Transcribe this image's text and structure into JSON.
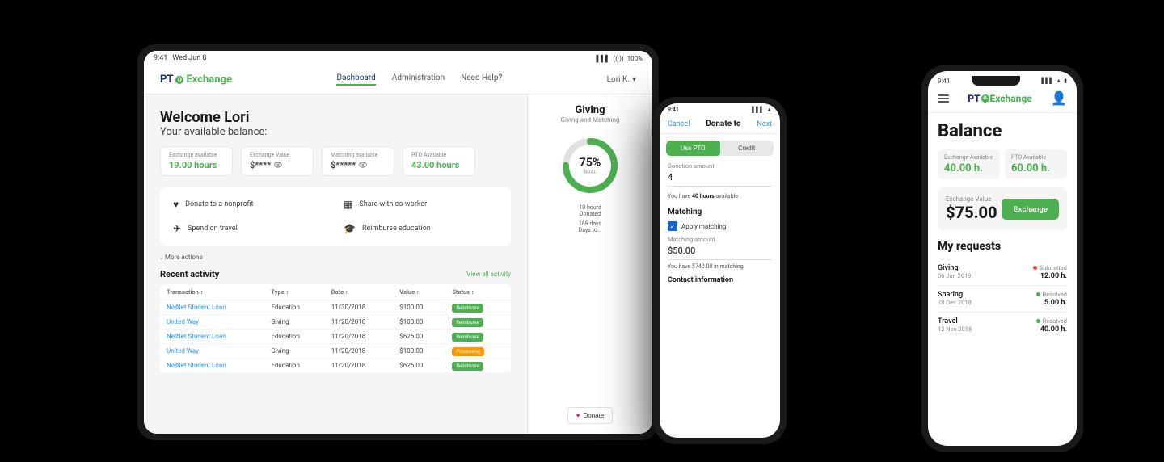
{
  "app": {
    "name": "PTO Exchange",
    "logo_pto": "PT",
    "logo_o": "O",
    "logo_exchange": "Exchange"
  },
  "tablet": {
    "status": {
      "time": "9:41",
      "date": "Wed Jun 8",
      "battery": "100%"
    },
    "nav": {
      "links": [
        "Dashboard",
        "Administration",
        "Need Help?"
      ],
      "active": "Dashboard",
      "user": "Lori K."
    },
    "welcome": {
      "greeting": "Welcome Lori",
      "balance_label": "Your available balance:"
    },
    "balance_cards": [
      {
        "label": "Exchange available",
        "value": "19.00 hours",
        "type": "text"
      },
      {
        "label": "Exchange Value",
        "value": "$****",
        "type": "masked"
      },
      {
        "label": "Matching available",
        "value": "$*****",
        "type": "masked"
      },
      {
        "label": "PTO Available",
        "value": "43.00 hours",
        "type": "text"
      }
    ],
    "actions": [
      {
        "icon": "♥",
        "label": "Donate to a nonprofit"
      },
      {
        "icon": "▦",
        "label": "Share with co-worker"
      },
      {
        "icon": "✈",
        "label": "Spend on travel"
      },
      {
        "icon": "🎓",
        "label": "Reimburse education"
      }
    ],
    "more_actions": "↓ More actions",
    "recent": {
      "title": "Recent activity",
      "view_all": "View all activity",
      "headers": [
        "Transaction ↕",
        "Type ↕",
        "Date ↕",
        "Value ↕",
        "Status ↕"
      ],
      "rows": [
        {
          "name": "NelNet Student Loan",
          "type": "Education",
          "date": "11/30/2018",
          "value": "$100.00",
          "status": "Reimburse"
        },
        {
          "name": "United Way",
          "type": "Giving",
          "date": "11/20/2018",
          "value": "$100.00",
          "status": "Reimburse"
        },
        {
          "name": "NelNet Student Loan",
          "type": "Education",
          "date": "11/20/2018",
          "value": "$625.00",
          "status": "Reimburse"
        },
        {
          "name": "United Way",
          "type": "Giving",
          "date": "11/20/2018",
          "value": "$100.00",
          "status": "Processing"
        },
        {
          "name": "NelNet Student Loan",
          "type": "Education",
          "date": "11/20/2018",
          "value": "$625.00",
          "status": "Reimburse"
        }
      ]
    },
    "giving": {
      "title": "Giving",
      "subtitle": "Giving and Matching",
      "percent": "75%",
      "goal_label": "GOAL",
      "donated": "10 hours",
      "donated_label": "Donated",
      "days": "169 days",
      "days_label": "Days to...",
      "donate_btn": "Donate"
    }
  },
  "phone1": {
    "status": {
      "time": "9:41"
    },
    "cancel": "Cancel",
    "title": "Donate to",
    "tabs": [
      "Use PTO",
      "Credit"
    ],
    "active_tab": "Use PTO",
    "donation": {
      "label": "Donation amount",
      "value": "4",
      "available_text": "You have",
      "available_hours": "40 hours",
      "available_suffix": "available"
    },
    "matching": {
      "title": "Matching",
      "checkbox_label": "Apply matching",
      "amount_label": "Matching amount",
      "amount": "$50.00",
      "available_label": "You have $740.00 in matching"
    },
    "contact": {
      "title": "Contact information"
    }
  },
  "phone2": {
    "status": {
      "time": "9:41"
    },
    "balance_title": "Balance",
    "exchange_available": {
      "label": "Exchange Available",
      "value": "40.00 h."
    },
    "pto_available": {
      "label": "PTO Available",
      "value": "60.00 h."
    },
    "exchange_value": {
      "label": "Exchange Value",
      "value": "$75.00"
    },
    "exchange_btn": "Exchange",
    "my_requests_title": "My requests",
    "requests": [
      {
        "title": "Giving",
        "date": "06 Jan 2019",
        "status": "Submitted",
        "status_type": "submitted",
        "amount": "12.00 h."
      },
      {
        "title": "Sharing",
        "date": "28 Dec 2018",
        "status": "Resolved",
        "status_type": "resolved",
        "amount": "5.00 h."
      },
      {
        "title": "Travel",
        "date": "12 Nov 2018",
        "status": "Resolved",
        "status_type": "resolved",
        "amount": "40.00 h."
      }
    ]
  }
}
